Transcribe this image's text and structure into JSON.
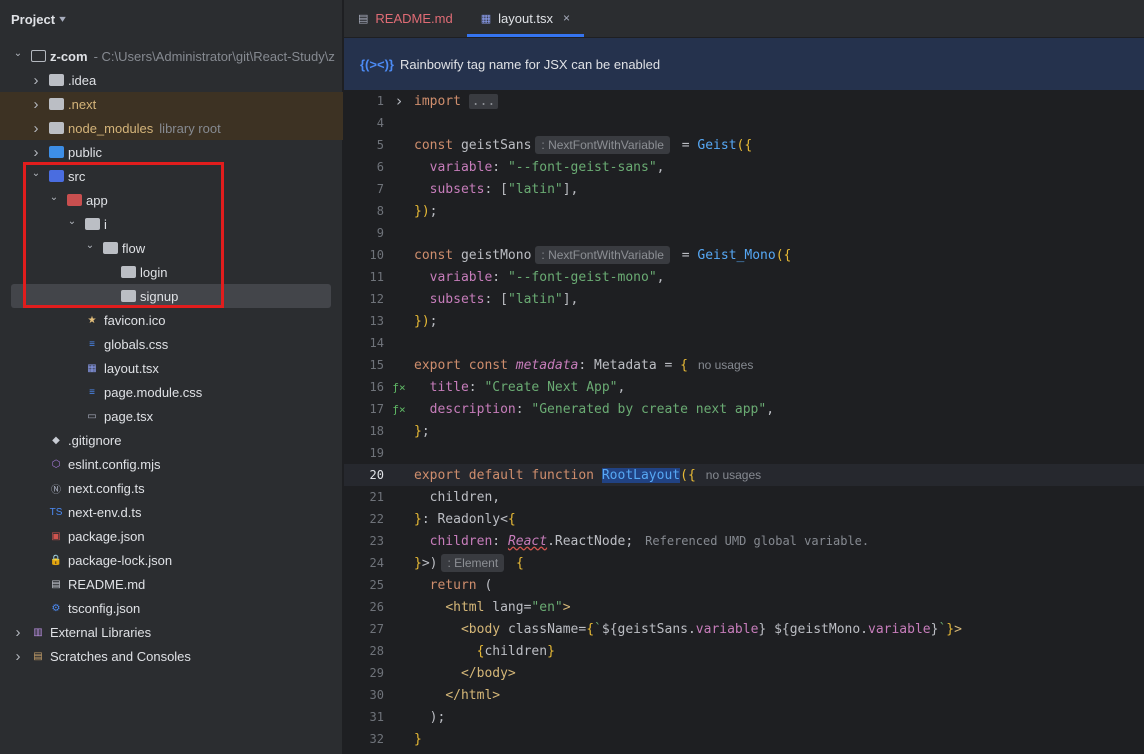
{
  "project_panel": {
    "title": "Project",
    "tree": [
      {
        "id": "z-com",
        "depth": 0,
        "expanded": true,
        "label": "z-com",
        "hint": "- C:\\Users\\Administrator\\git\\React-Study\\z",
        "icon": "module-folder-icon",
        "bold": true
      },
      {
        "id": "idea",
        "depth": 1,
        "expanded": false,
        "label": ".idea",
        "icon": "folder-icon"
      },
      {
        "id": "next",
        "depth": 1,
        "expanded": false,
        "label": ".next",
        "icon": "next-folder-icon",
        "excluded": true
      },
      {
        "id": "node_modules",
        "depth": 1,
        "expanded": false,
        "label": "node_modules",
        "hint": "library root",
        "icon": "folder-icon",
        "excluded": true
      },
      {
        "id": "public",
        "depth": 1,
        "expanded": false,
        "label": "public",
        "icon": "web-folder-icon"
      },
      {
        "id": "src",
        "depth": 1,
        "expanded": true,
        "label": "src",
        "icon": "source-folder-icon"
      },
      {
        "id": "app",
        "depth": 2,
        "expanded": true,
        "label": "app",
        "icon": "app-folder-icon"
      },
      {
        "id": "i",
        "depth": 3,
        "expanded": true,
        "label": "i",
        "icon": "folder-icon"
      },
      {
        "id": "flow",
        "depth": 4,
        "expanded": true,
        "label": "flow",
        "icon": "folder-icon"
      },
      {
        "id": "login",
        "depth": 5,
        "label": "login",
        "icon": "folder-icon"
      },
      {
        "id": "signup",
        "depth": 5,
        "label": "signup",
        "icon": "folder-icon",
        "selected": true
      },
      {
        "id": "favicon",
        "depth": 3,
        "label": "favicon.ico",
        "icon": "star-icon"
      },
      {
        "id": "globals",
        "depth": 3,
        "label": "globals.css",
        "icon": "css-icon"
      },
      {
        "id": "layout",
        "depth": 3,
        "label": "layout.tsx",
        "icon": "tsx-icon"
      },
      {
        "id": "pagemodule",
        "depth": 3,
        "label": "page.module.css",
        "icon": "css-icon"
      },
      {
        "id": "pagetsx",
        "depth": 3,
        "label": "page.tsx",
        "icon": "page-icon"
      },
      {
        "id": "gitignore",
        "depth": 1,
        "label": ".gitignore",
        "icon": "git-icon"
      },
      {
        "id": "eslint",
        "depth": 1,
        "label": "eslint.config.mjs",
        "icon": "eslint-icon"
      },
      {
        "id": "nextconfig",
        "depth": 1,
        "label": "next.config.ts",
        "icon": "next-icon"
      },
      {
        "id": "nextenv",
        "depth": 1,
        "label": "next-env.d.ts",
        "icon": "ts-icon"
      },
      {
        "id": "package",
        "depth": 1,
        "label": "package.json",
        "icon": "npm-icon"
      },
      {
        "id": "packagelock",
        "depth": 1,
        "label": "package-lock.json",
        "icon": "lock-icon"
      },
      {
        "id": "readme",
        "depth": 1,
        "label": "README.md",
        "icon": "markdown-icon"
      },
      {
        "id": "tsconfig",
        "depth": 1,
        "label": "tsconfig.json",
        "icon": "tsconfig-icon"
      },
      {
        "id": "extlib",
        "depth": 0,
        "expanded": false,
        "label": "External Libraries",
        "icon": "library-icon"
      },
      {
        "id": "scratches",
        "depth": 0,
        "expanded": false,
        "label": "Scratches and Consoles",
        "icon": "scratches-icon"
      }
    ]
  },
  "tabs": [
    {
      "label": "README.md",
      "icon": "markdown-icon",
      "active": false
    },
    {
      "label": "layout.tsx",
      "icon": "tsx-icon",
      "active": true,
      "close": "×"
    }
  ],
  "banner": {
    "icon_text": "{(><)}",
    "text": "Rainbowify tag name for JSX can be enabled"
  },
  "editor": {
    "current_line": 20,
    "lines": [
      {
        "n": 1,
        "html": "<span class='kw'>import</span> <span class='fold-dots'>...</span>",
        "fold": true
      },
      {
        "n": 4,
        "html": ""
      },
      {
        "n": 5,
        "html": "<span class='kw'>const</span> geistSans<span class='inlay'>: NextFontWithVariable</span> = <span class='fn'>Geist</span><span class='brace'>({</span>"
      },
      {
        "n": 6,
        "html": "  <span class='prop'>variable</span>: <span class='str'>\"--font-geist-sans\"</span>,"
      },
      {
        "n": 7,
        "html": "  <span class='prop'>subsets</span>: [<span class='str'>\"latin\"</span>],"
      },
      {
        "n": 8,
        "html": "<span class='brace'>})</span>;"
      },
      {
        "n": 9,
        "html": ""
      },
      {
        "n": 10,
        "html": "<span class='kw'>const</span> geistMono<span class='inlay'>: NextFontWithVariable</span> = <span class='fn'>Geist_Mono</span><span class='brace'>({</span>"
      },
      {
        "n": 11,
        "html": "  <span class='prop'>variable</span>: <span class='str'>\"--font-geist-mono\"</span>,"
      },
      {
        "n": 12,
        "html": "  <span class='prop'>subsets</span>: [<span class='str'>\"latin\"</span>],"
      },
      {
        "n": 13,
        "html": "<span class='brace'>})</span>;"
      },
      {
        "n": 14,
        "html": ""
      },
      {
        "n": 15,
        "html": "<span class='kw'>export const</span> <span class='prop it'>metadata</span>: Metadata = <span class='brace'>{</span><span class='usages'>no usages</span>"
      },
      {
        "n": 16,
        "html": "  <span class='prop'>title</span>: <span class='str'>\"Create Next App\"</span>,",
        "marker": "ƒ×"
      },
      {
        "n": 17,
        "html": "  <span class='prop'>description</span>: <span class='str'>\"Generated by create next app\"</span>,",
        "marker": "ƒ×"
      },
      {
        "n": 18,
        "html": "<span class='brace'>}</span>;"
      },
      {
        "n": 19,
        "html": ""
      },
      {
        "n": 20,
        "html": "<span class='kw'>export default function</span> <span class='hl-name'>RootLayout</span><span class='brace'>({</span><span class='usages'>no usages</span>"
      },
      {
        "n": 21,
        "html": "  children,"
      },
      {
        "n": 22,
        "html": "<span class='brace'>}</span>: Readonly&lt;<span class='brace'>{</span>"
      },
      {
        "n": 23,
        "html": "  <span class='prop'>children</span>: <span class='squiggle it' style='color:#c77dbb'>React</span>.ReactNode;<span class='comment-hint'>Referenced UMD global variable.</span>"
      },
      {
        "n": 24,
        "html": "<span class='brace'>}</span>&gt;)<span class='inlay'>: Element</span> <span class='brace'>{</span>"
      },
      {
        "n": 25,
        "html": "  <span class='kw'>return</span> ("
      },
      {
        "n": 26,
        "html": "    <span class='tag'>&lt;html</span> <span class='attr'>lang</span>=<span class='str'>\"en\"</span><span class='tag'>&gt;</span>"
      },
      {
        "n": 27,
        "html": "      <span class='tag'>&lt;body</span> <span class='attr'>className</span>=<span class='brace'>{</span><span class='str'>`</span>${geistSans.<span class='prop'>variable</span>} ${geistMono.<span class='prop'>variable</span>}<span class='str'>`</span><span class='brace'>}</span><span class='tag'>&gt;</span>"
      },
      {
        "n": 28,
        "html": "        <span class='brace'>{</span>children<span class='brace'>}</span>"
      },
      {
        "n": 29,
        "html": "      <span class='tag'>&lt;/body&gt;</span>"
      },
      {
        "n": 30,
        "html": "    <span class='tag'>&lt;/html&gt;</span>"
      },
      {
        "n": 31,
        "html": "  );"
      },
      {
        "n": 32,
        "html": "<span class='brace'>}</span>"
      }
    ]
  },
  "colors": {
    "accent": "#3574f0",
    "highlight_box": "#e11d1d"
  }
}
